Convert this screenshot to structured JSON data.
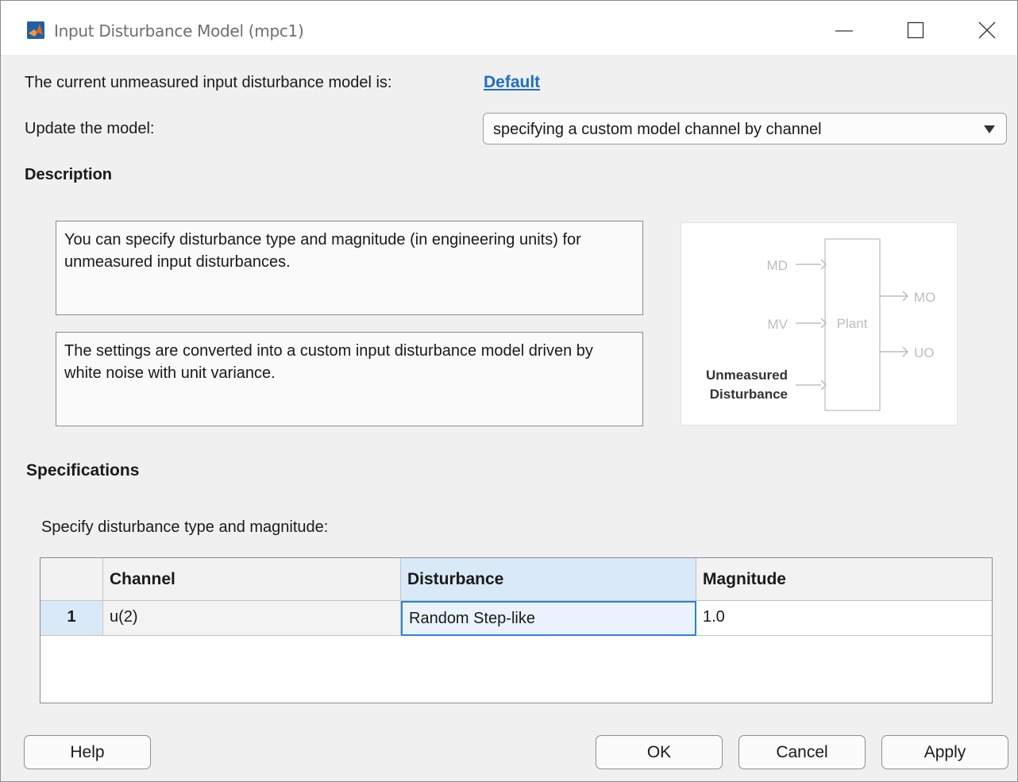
{
  "window": {
    "title": "Input Disturbance Model (mpc1)",
    "controls": [
      "minimize",
      "maximize",
      "close"
    ]
  },
  "current_model": {
    "label": "The current unmeasured input disturbance model is:",
    "value_link": "Default"
  },
  "update": {
    "label": "Update the model:",
    "selected": "specifying a custom model channel by channel"
  },
  "description": {
    "heading": "Description",
    "text1": "You can specify disturbance type and magnitude (in engineering units) for unmeasured input disturbances.",
    "text2": "The settings are converted into a custom input disturbance model driven by white noise with unit variance."
  },
  "diagram": {
    "inputs": [
      "MD",
      "MV"
    ],
    "unmeasured_line1": "Unmeasured",
    "unmeasured_line2": "Disturbance",
    "block": "Plant",
    "outputs": [
      "MO",
      "UO"
    ]
  },
  "specifications": {
    "heading": "Specifications",
    "instruction": "Specify disturbance type and magnitude:",
    "columns": [
      "",
      "Channel",
      "Disturbance",
      "Magnitude"
    ],
    "rows": [
      {
        "index": "1",
        "channel": "u(2)",
        "disturbance": "Random Step-like",
        "magnitude": "1.0"
      }
    ]
  },
  "buttons": {
    "help": "Help",
    "ok": "OK",
    "cancel": "Cancel",
    "apply": "Apply"
  },
  "colors": {
    "link": "#1f6ec7",
    "selection": "#d9e9f8",
    "active_cell_border": "#2a82d8",
    "matlab_icon": "#e2661a"
  }
}
